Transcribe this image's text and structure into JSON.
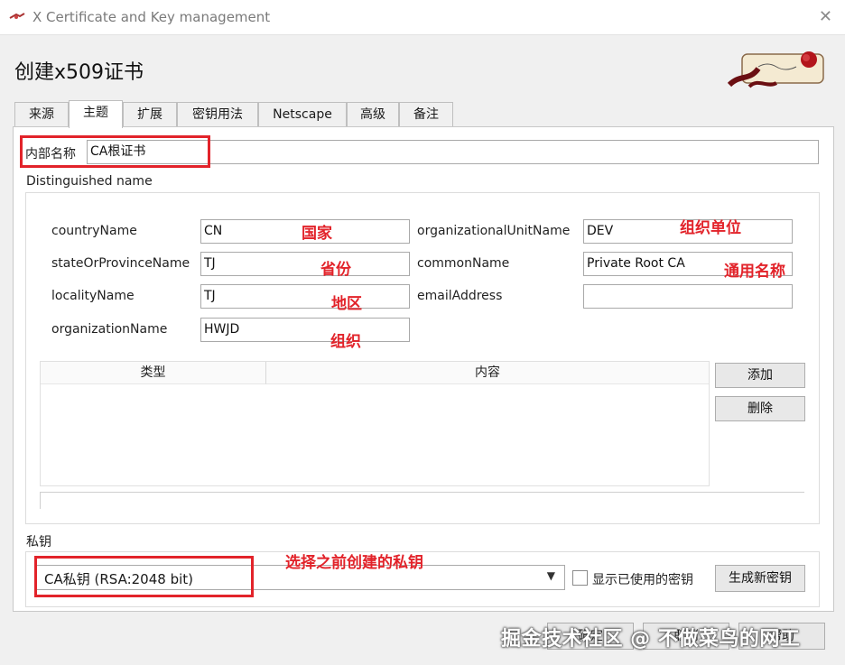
{
  "window": {
    "title": "X Certificate and Key management",
    "close_symbol": "✕"
  },
  "page": {
    "heading": "创建x509证书"
  },
  "tabs": [
    {
      "label": "来源"
    },
    {
      "label": "主题"
    },
    {
      "label": "扩展"
    },
    {
      "label": "密钥用法"
    },
    {
      "label": "Netscape"
    },
    {
      "label": "高级"
    },
    {
      "label": "备注"
    }
  ],
  "active_tab": "主题",
  "internal_name": {
    "label": "内部名称",
    "value": "CA根证书"
  },
  "dn": {
    "group_label": "Distinguished name",
    "fields": {
      "countryName": {
        "label": "countryName",
        "value": "CN"
      },
      "stateOrProvinceName": {
        "label": "stateOrProvinceName",
        "value": "TJ"
      },
      "localityName": {
        "label": "localityName",
        "value": "TJ"
      },
      "organizationName": {
        "label": "organizationName",
        "value": "HWJD"
      },
      "organizationalUnitName": {
        "label": "organizationalUnitName",
        "value": "DEV"
      },
      "commonName": {
        "label": "commonName",
        "value": "Private Root CA"
      },
      "emailAddress": {
        "label": "emailAddress",
        "value": ""
      }
    },
    "table": {
      "columns": [
        "类型",
        "内容"
      ],
      "rows": []
    },
    "add_button": "添加",
    "delete_button": "删除"
  },
  "private_key": {
    "group_label": "私钥",
    "selected": "CA私钥 (RSA:2048 bit)",
    "show_used_label": "显示已使用的密钥",
    "show_used_checked": false,
    "generate_button": "生成新密钥"
  },
  "annotations": {
    "country": "国家",
    "state": "省份",
    "locality": "地区",
    "organization": "组织",
    "org_unit": "组织单位",
    "common_name": "通用名称",
    "private_key_hint": "选择之前创建的私钥"
  },
  "footer": {
    "ok_button": "确定",
    "cancel_button": "取消",
    "help_button": "帮助"
  },
  "watermark": "掘金技术社区 @ 不做菜鸟的网工",
  "colors": {
    "annotation_red": "#e2232a",
    "background": "#f0f0f0"
  }
}
